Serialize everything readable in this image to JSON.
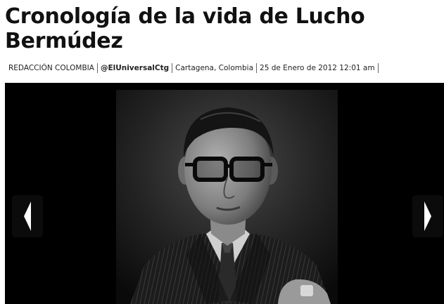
{
  "article": {
    "title": "Cronología de la vida de Lucho Bermúdez"
  },
  "byline": {
    "author": "REDACCIÓN COLOMBIA",
    "twitter": "@ElUniversalCtg",
    "location": "Cartagena, Colombia",
    "datetime": "25 de Enero de 2012 12:01 am"
  },
  "gallery": {
    "prev_icon": "chevron-left-icon",
    "next_icon": "chevron-right-icon",
    "colors": {
      "background": "#000000",
      "arrow": "#ffffff"
    }
  }
}
